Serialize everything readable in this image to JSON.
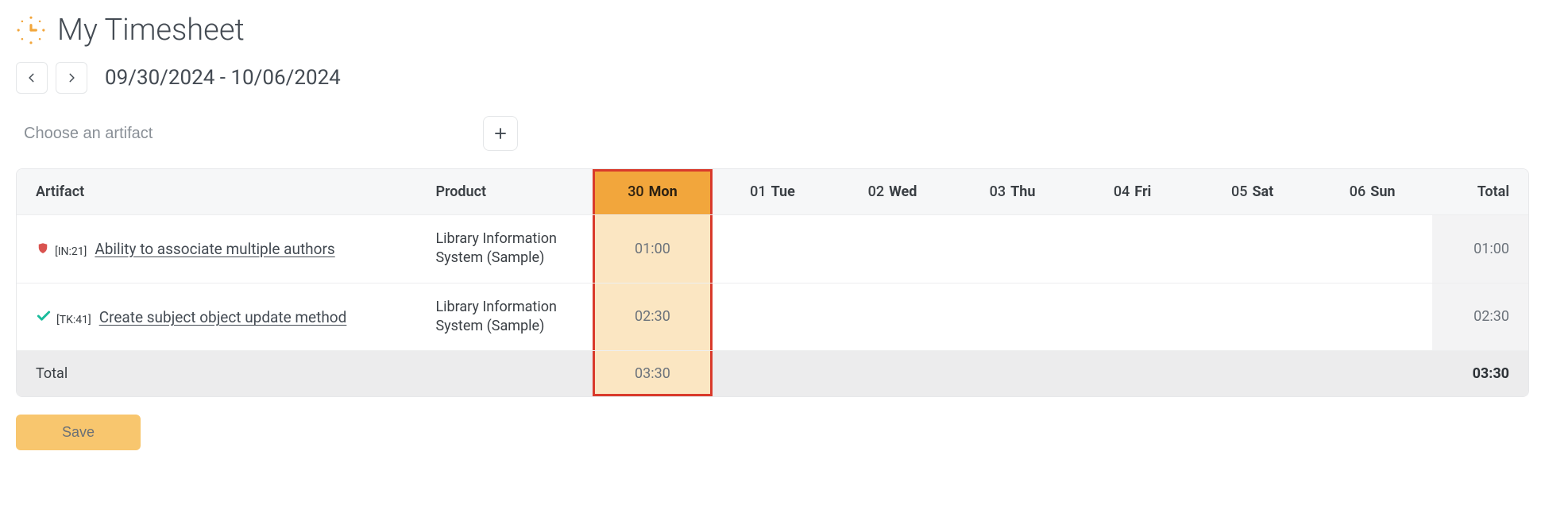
{
  "title": "My Timesheet",
  "range": "09/30/2024 - 10/06/2024",
  "choose_placeholder": "Choose an artifact",
  "columns": {
    "artifact": "Artifact",
    "product": "Product",
    "total": "Total"
  },
  "days": [
    {
      "num": "30",
      "name": "Mon",
      "highlight": true
    },
    {
      "num": "01",
      "name": "Tue"
    },
    {
      "num": "02",
      "name": "Wed"
    },
    {
      "num": "03",
      "name": "Thu"
    },
    {
      "num": "04",
      "name": "Fri"
    },
    {
      "num": "05",
      "name": "Sat"
    },
    {
      "num": "06",
      "name": "Sun"
    }
  ],
  "rows": [
    {
      "icon": "shield",
      "id_label": "[IN:21]",
      "name": "Ability to associate multiple authors",
      "product": "Library Information System (Sample)",
      "values": [
        "01:00",
        "",
        "",
        "",
        "",
        "",
        ""
      ],
      "row_total": "01:00"
    },
    {
      "icon": "check",
      "id_label": "[TK:41]",
      "name": "Create subject object update method",
      "product": "Library Information System (Sample)",
      "values": [
        "02:30",
        "",
        "",
        "",
        "",
        "",
        ""
      ],
      "row_total": "02:30"
    }
  ],
  "totals": {
    "label": "Total",
    "per_day": [
      "03:30",
      "",
      "",
      "",
      "",
      "",
      ""
    ],
    "grand": "03:30"
  },
  "save_label": "Save"
}
